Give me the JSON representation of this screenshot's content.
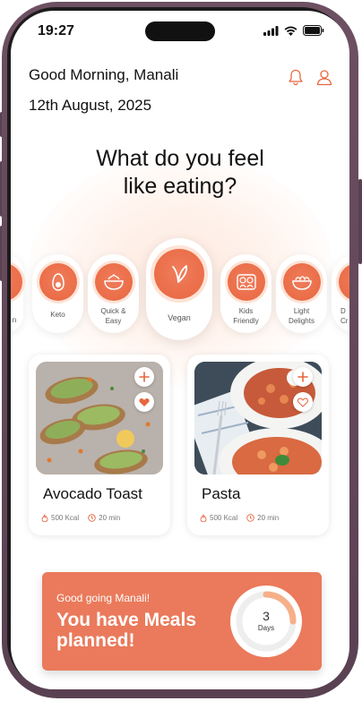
{
  "status": {
    "time": "19:27"
  },
  "header": {
    "greeting": "Good Morning, Manali",
    "date": "12th August, 2025"
  },
  "headline": "What do you feel like eating?",
  "headline_lines": [
    "What do you feel",
    "like eating?"
  ],
  "categories": [
    {
      "label": "n",
      "icon": "food-icon"
    },
    {
      "label": "Keto",
      "icon": "avocado-icon"
    },
    {
      "label": "Quick &\nEasy",
      "icon": "bowl-icon"
    },
    {
      "label": "Vegan",
      "icon": "leaf-icon",
      "selected": true
    },
    {
      "label": "Kids\nFriendly",
      "icon": "kids-icon"
    },
    {
      "label": "Light\nDelights",
      "icon": "salad-icon"
    },
    {
      "label": "D\nCr",
      "icon": "food-icon"
    }
  ],
  "meals": [
    {
      "name": "Avocado Toast",
      "kcal": "500 Kcal",
      "time": "20 min",
      "liked": true
    },
    {
      "name": "Pasta",
      "kcal": "500 Kcal",
      "time": "20 min",
      "liked": false
    }
  ],
  "banner": {
    "subtitle": "Good going Manali!",
    "title": "You have Meals planned!",
    "days_value": "3",
    "days_label": "Days",
    "progress": 0.25
  },
  "colors": {
    "accent": "#ea7a5b",
    "accent_light": "#fde3d6"
  }
}
